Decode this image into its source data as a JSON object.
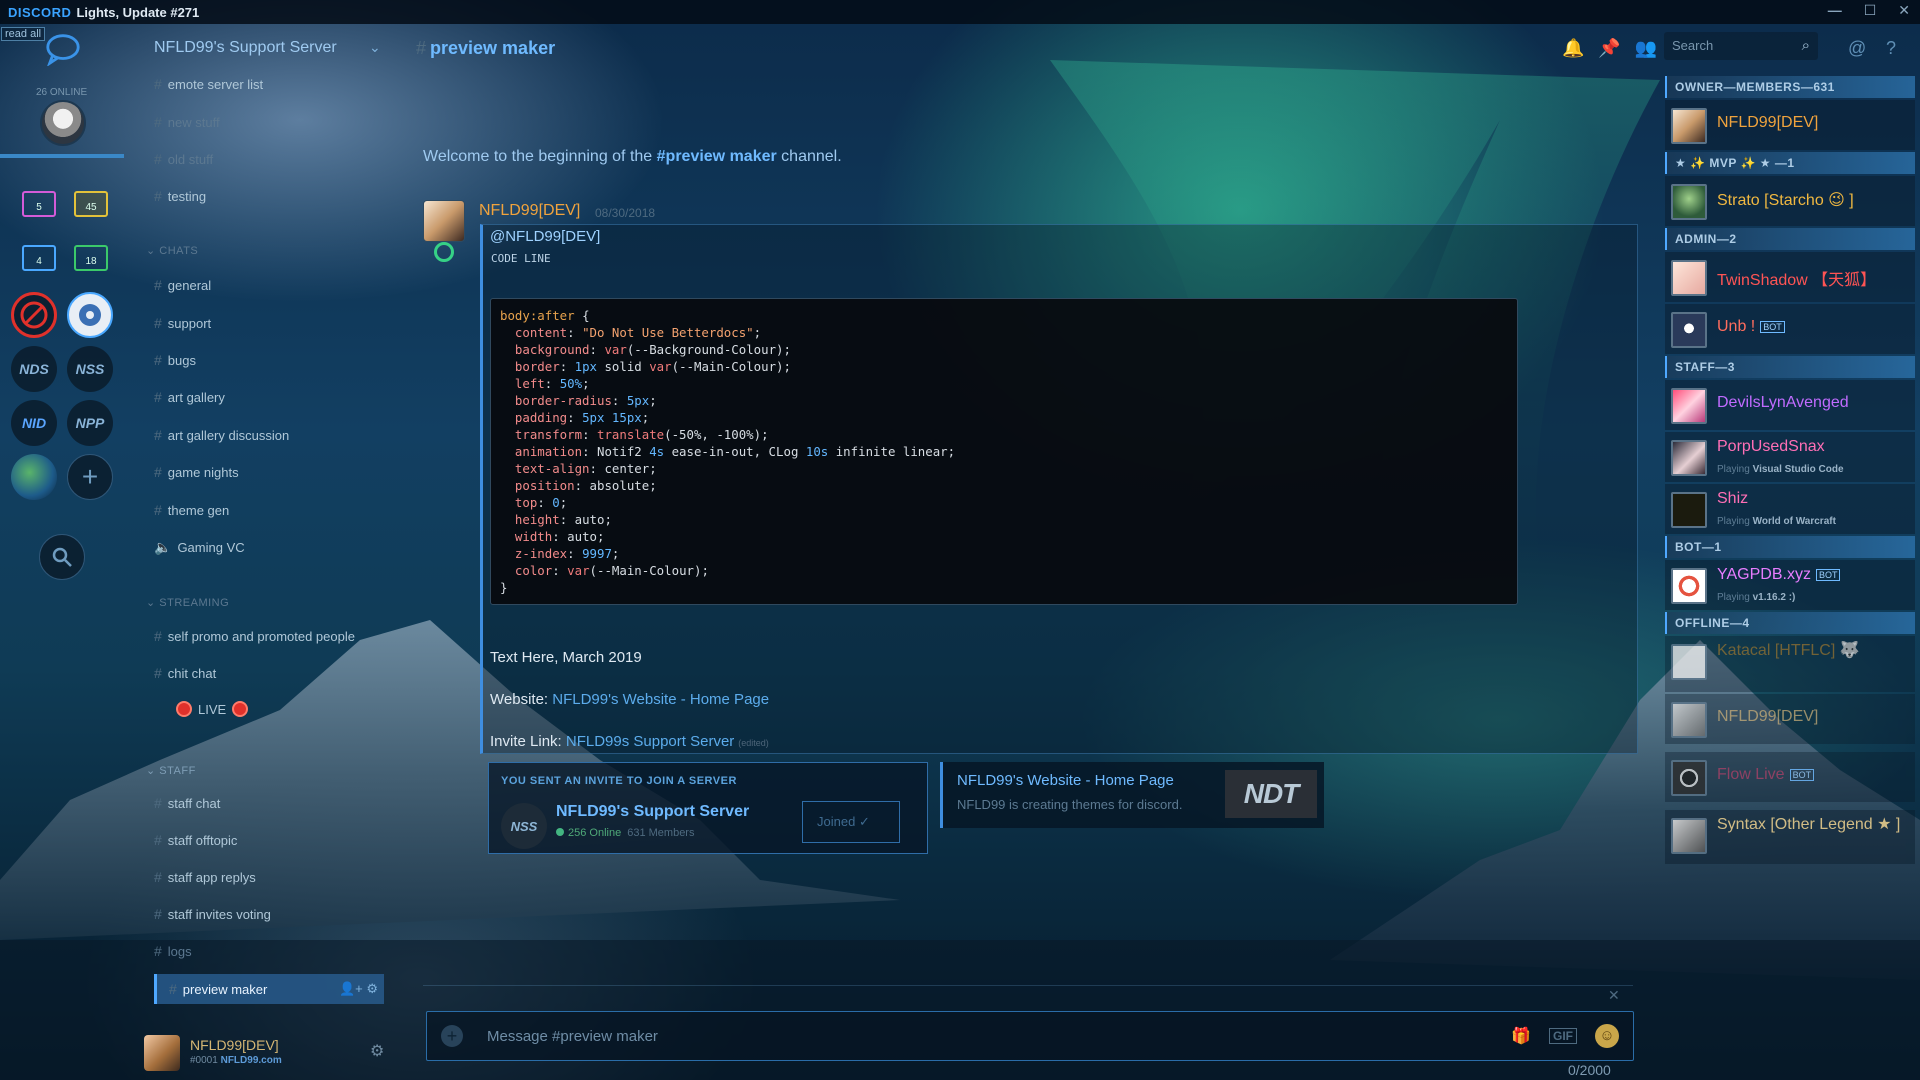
{
  "window": {
    "app_name": "DISCORD",
    "title": "Lights, Update #271"
  },
  "guilds": {
    "read_all": "read all",
    "online_count": "26 ONLINE",
    "folders": [
      {
        "badge": "5"
      },
      {
        "badge": "45"
      },
      {
        "badge": "4"
      },
      {
        "badge": "18"
      }
    ],
    "servers": [
      {
        "label": "NDS"
      },
      {
        "label": "NSS"
      },
      {
        "label": "NID"
      },
      {
        "label": "NPP"
      }
    ],
    "add_server": "+"
  },
  "server": {
    "name": "NFLD99's Support Server",
    "channels_top": [
      {
        "name": "emote server list",
        "muted": false
      },
      {
        "name": "new stuff",
        "muted": true
      },
      {
        "name": "old stuff",
        "muted": true
      },
      {
        "name": "testing",
        "muted": false
      }
    ],
    "category_chats": "CHATS",
    "channels_chats": [
      {
        "name": "general"
      },
      {
        "name": "support"
      },
      {
        "name": "bugs"
      },
      {
        "name": "art gallery"
      },
      {
        "name": "art gallery discussion"
      },
      {
        "name": "game nights"
      },
      {
        "name": "theme gen"
      },
      {
        "name": "Gaming VC"
      }
    ],
    "category_streaming": "STREAMING",
    "channels_streaming": [
      {
        "name": "self promo and promoted people"
      },
      {
        "name": "chit chat"
      }
    ],
    "live_label": "LIVE",
    "category_staff": "STAFF",
    "channels_staff": [
      {
        "name": "staff chat"
      },
      {
        "name": "staff offtopic"
      },
      {
        "name": "staff app replys"
      },
      {
        "name": "staff invites voting"
      },
      {
        "name": "logs"
      }
    ],
    "selected_channel": "preview maker"
  },
  "user": {
    "name": "NFLD99[DEV]",
    "discriminator": "#0001",
    "site": "NFLD99.com"
  },
  "header": {
    "channel": "preview maker",
    "search_placeholder": "Search"
  },
  "chat": {
    "welcome_prefix": "Welcome to the beginning of the ",
    "welcome_channel": "#preview maker",
    "welcome_suffix": " channel.",
    "message": {
      "author": "NFLD99[DEV]",
      "date": "08/30/2018",
      "mention": "@NFLD99[DEV]",
      "code_line": "CODE LINE",
      "text_line": "Text Here, March 2019",
      "website_label": "Website: ",
      "website_link": "NFLD99's Website - Home Page",
      "invite_label": "Invite Link: ",
      "invite_link": "NFLD99s Support Server",
      "edited": "(edited)"
    },
    "invite": {
      "heading": "YOU SENT AN INVITE TO JOIN A SERVER",
      "icon": "NSS",
      "server_name": "NFLD99's Support Server",
      "online": "256 Online",
      "members": "631 Members",
      "button": "Joined"
    },
    "embed": {
      "title": "NFLD99's Website - Home Page",
      "description": "NFLD99 is creating themes for discord.",
      "thumb": "NDT"
    },
    "input_placeholder": "Message #preview maker",
    "char_count": "0/2000"
  },
  "members": {
    "categories": [
      "OWNER—MEMBERS—631",
      "★ ✨ MVP ✨ ★ —1",
      "ADMIN—2",
      "STAFF—3",
      "BOT—1",
      "OFFLINE—4"
    ],
    "list": [
      {
        "name": "NFLD99[DEV]",
        "color": "#f0a33d",
        "game": "",
        "game_name": "",
        "bot": false
      },
      {
        "name": "Strato [Starcho 😉 ]",
        "color": "#f0b840",
        "game": "",
        "game_name": "",
        "bot": false
      },
      {
        "name": "TwinShadow 【天狐】",
        "color": "#ff5454",
        "game": "",
        "game_name": "",
        "bot": false
      },
      {
        "name": "Unb !",
        "color": "#ff6d5e",
        "game": "",
        "game_name": "",
        "bot": true
      },
      {
        "name": "DevilsLynAvenged",
        "color": "#c06bff",
        "game": "",
        "game_name": "",
        "bot": false
      },
      {
        "name": "PorpUsedSnax",
        "color": "#ff6fb5",
        "game": "Playing ",
        "game_name": "Visual Studio Code",
        "bot": false
      },
      {
        "name": "Shiz",
        "color": "#ff6fb5",
        "game": "Playing ",
        "game_name": "World of Warcraft",
        "bot": false
      },
      {
        "name": "YAGPDB.xyz",
        "color": "#e77dff",
        "game": "Playing ",
        "game_name": "v1.16.2 :)",
        "bot": true
      },
      {
        "name": "Katacal [HTFLC] 🐺",
        "color": "#8a6a2e",
        "game": "",
        "game_name": "",
        "bot": false
      },
      {
        "name": "NFLD99[DEV]",
        "color": "#b8a070",
        "game": "",
        "game_name": "",
        "bot": false
      },
      {
        "name": "Flow Live",
        "color": "#a23c61",
        "game": "",
        "game_name": "",
        "bot": true
      },
      {
        "name": "Syntax [Other Legend ★ ]",
        "color": "#e4c98a",
        "game": "",
        "game_name": "",
        "bot": false
      }
    ],
    "bot_tag": "BOT"
  }
}
